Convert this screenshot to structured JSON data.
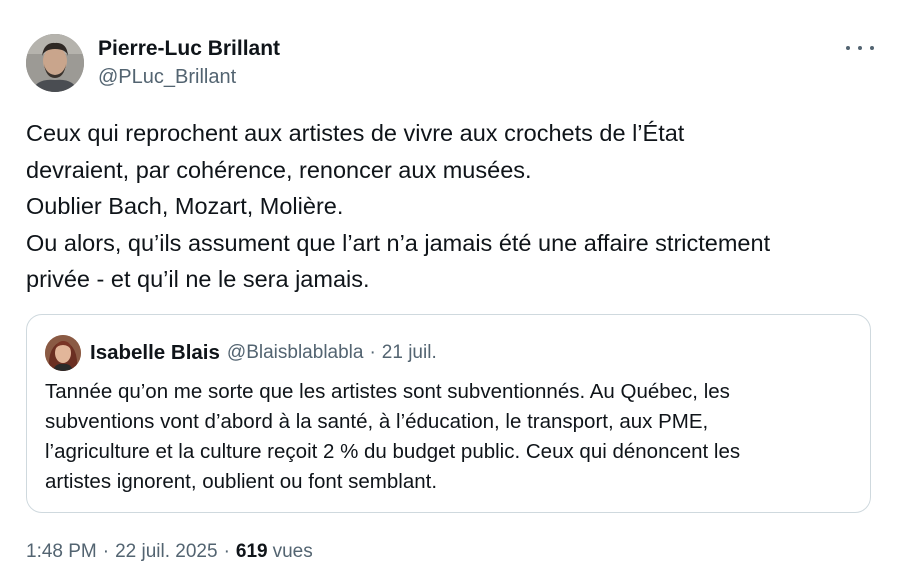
{
  "tweet": {
    "author": {
      "display_name": "Pierre-Luc Brillant",
      "handle": "@PLuc_Brillant"
    },
    "more_icon": "more-horizontal-icon",
    "text_lines": [
      "Ceux qui reprochent aux artistes de vivre aux crochets de l’État",
      "devraient, par cohérence, renoncer aux musées.",
      "Oublier Bach, Mozart, Molière.",
      "Ou alors, qu’ils assument que l’art n’a jamais été une affaire strictement",
      "privée - et qu’il ne le sera jamais."
    ],
    "quote": {
      "display_name": "Isabelle Blais",
      "handle": "@Blaisblablabla",
      "separator": "·",
      "date": "21 juil.",
      "text_lines": [
        "Tannée qu’on me sorte que les artistes sont subventionnés. Au Québec, les",
        "subventions vont d’abord à la santé, à l’éducation, le transport, aux PME,",
        "l’agriculture et la culture reçoit 2 % du budget public. Ceux qui dénoncent les",
        "artistes ignorent, oublient ou font semblant."
      ]
    },
    "meta": {
      "time": "1:48 PM",
      "separator": "·",
      "date": "22 juil. 2025",
      "views_count": "619",
      "views_label": "vues"
    }
  },
  "colors": {
    "text_primary": "#0f1419",
    "text_secondary": "#536471",
    "border": "#cfd9de",
    "background": "#ffffff"
  }
}
